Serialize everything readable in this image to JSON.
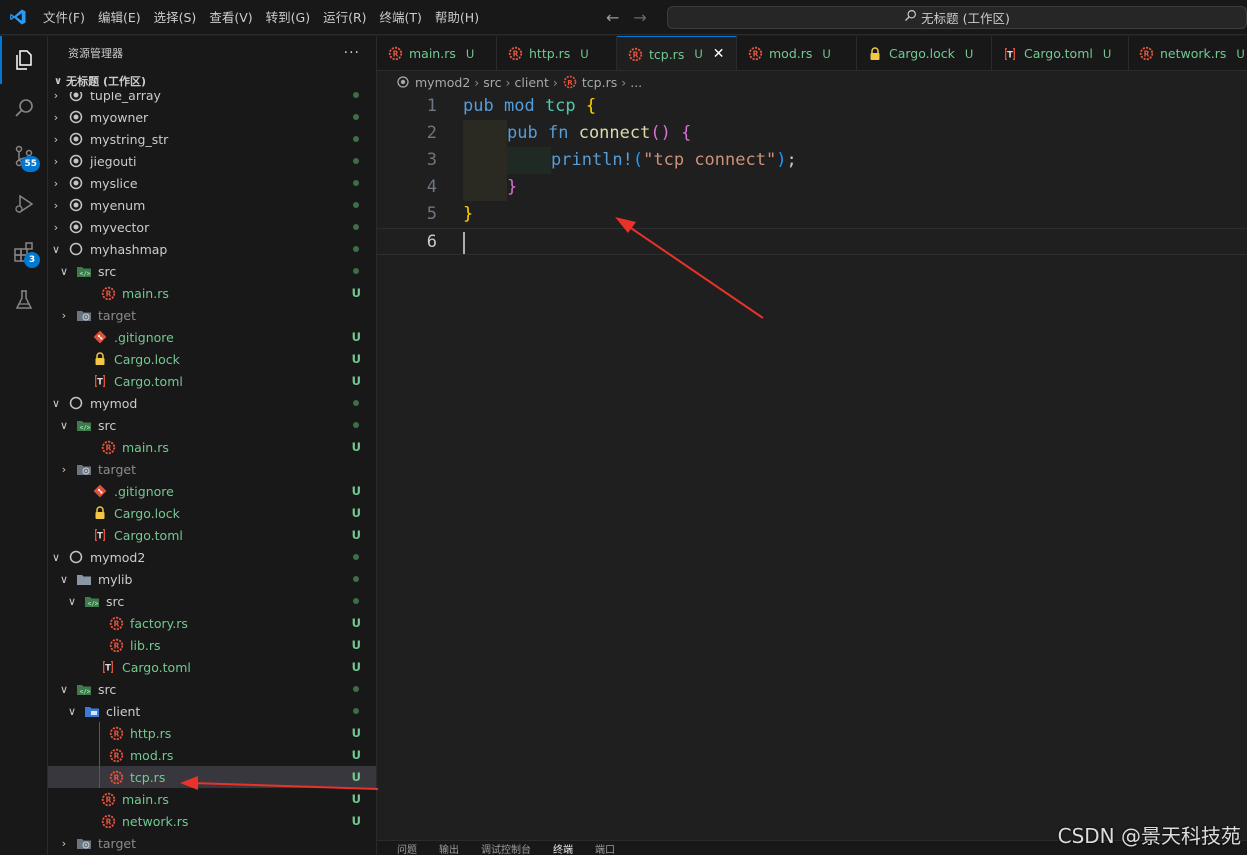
{
  "menu": [
    "文件(F)",
    "编辑(E)",
    "选择(S)",
    "查看(V)",
    "转到(G)",
    "运行(R)",
    "终端(T)",
    "帮助(H)"
  ],
  "search": {
    "text": "无标题 (工作区)"
  },
  "activity": {
    "scm_badge": "55",
    "extensions_badge": "3"
  },
  "sidebar": {
    "title": "资源管理器",
    "more": "···",
    "workspace": "无标题 (工作区)",
    "rows": [
      {
        "label": "tuple_array",
        "status": ""
      },
      {
        "label": "myowner",
        "status": ""
      },
      {
        "label": "mystring_str",
        "status": ""
      },
      {
        "label": "jiegouti",
        "status": ""
      },
      {
        "label": "myslice",
        "status": ""
      },
      {
        "label": "myenum",
        "status": ""
      },
      {
        "label": "myvector",
        "status": ""
      },
      {
        "label": "myhashmap",
        "status": ""
      },
      {
        "label": "src",
        "status": ""
      },
      {
        "label": "main.rs",
        "status": "U"
      },
      {
        "label": "target",
        "status": ""
      },
      {
        "label": ".gitignore",
        "status": "U"
      },
      {
        "label": "Cargo.lock",
        "status": "U"
      },
      {
        "label": "Cargo.toml",
        "status": "U"
      },
      {
        "label": "mymod",
        "status": ""
      },
      {
        "label": "src",
        "status": ""
      },
      {
        "label": "main.rs",
        "status": "U"
      },
      {
        "label": "target",
        "status": ""
      },
      {
        "label": ".gitignore",
        "status": "U"
      },
      {
        "label": "Cargo.lock",
        "status": "U"
      },
      {
        "label": "Cargo.toml",
        "status": "U"
      },
      {
        "label": "mymod2",
        "status": ""
      },
      {
        "label": "mylib",
        "status": ""
      },
      {
        "label": "src",
        "status": ""
      },
      {
        "label": "factory.rs",
        "status": "U"
      },
      {
        "label": "lib.rs",
        "status": "U"
      },
      {
        "label": "Cargo.toml",
        "status": "U"
      },
      {
        "label": "src",
        "status": ""
      },
      {
        "label": "client",
        "status": ""
      },
      {
        "label": "http.rs",
        "status": "U"
      },
      {
        "label": "mod.rs",
        "status": "U"
      },
      {
        "label": "tcp.rs",
        "status": "U"
      },
      {
        "label": "main.rs",
        "status": "U"
      },
      {
        "label": "network.rs",
        "status": "U"
      },
      {
        "label": "target",
        "status": ""
      }
    ]
  },
  "tabs": [
    {
      "label": "main.rs",
      "status": "U"
    },
    {
      "label": "http.rs",
      "status": "U"
    },
    {
      "label": "tcp.rs",
      "status": "U"
    },
    {
      "label": "mod.rs",
      "status": "U"
    },
    {
      "label": "Cargo.lock",
      "status": "U"
    },
    {
      "label": "Cargo.toml",
      "status": "U"
    },
    {
      "label": "network.rs",
      "status": "U"
    }
  ],
  "breadcrumb": [
    "mymod2",
    "src",
    "client",
    "tcp.rs",
    "..."
  ],
  "editor": {
    "line_numbers": [
      "1",
      "2",
      "3",
      "4",
      "5",
      "6"
    ],
    "l1": {
      "kw1": "pub",
      "kw2": "mod",
      "name": "tcp",
      "brace": "{"
    },
    "l2": {
      "kw1": "pub",
      "kw2": "fn",
      "name": "connect",
      "parens": "()",
      "brace": "{"
    },
    "l3": {
      "mac": "println!",
      "open": "(",
      "str": "\"tcp connect\"",
      "close": ")",
      "semi": ";"
    },
    "l4": {
      "brace": "}"
    },
    "l5": {
      "brace": "}"
    }
  },
  "panel_tabs": [
    "问题",
    "输出",
    "调试控制台",
    "终端",
    "端口"
  ],
  "watermark": "CSDN @景天科技苑"
}
